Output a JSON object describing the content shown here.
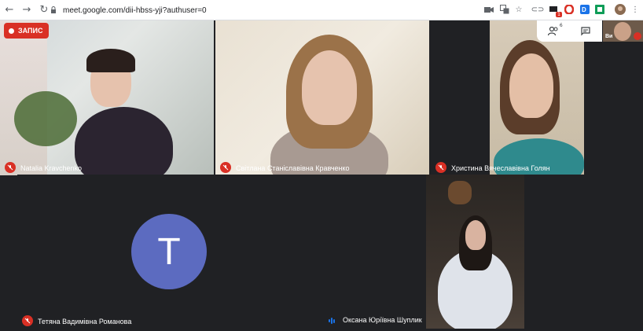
{
  "browser": {
    "url": "meet.google.com/dii-hbss-yji?authuser=0",
    "nav": {
      "back": "←",
      "forward": "→",
      "reload": "↻"
    },
    "extensions": [
      "camera-icon",
      "translate-icon",
      "star-icon",
      "link-icon",
      "mail-icon",
      "opera-icon",
      "dp-icon",
      "sheets-icon",
      "profile-icon",
      "menu-icon"
    ],
    "badge_count": "1"
  },
  "recording": {
    "label": "ЗАПИС",
    "color": "#d93025"
  },
  "panel": {
    "people_count": "6"
  },
  "self": {
    "label": "Ви"
  },
  "tiles": [
    {
      "name": "Natalia Kravchenko",
      "muted": true
    },
    {
      "name": "Світлана Станіславівна Кравченко",
      "muted": true
    },
    {
      "name": "Христина Вячеславівна Голян",
      "muted": true
    },
    {
      "name": "Тетяна Вадимівна Романова",
      "muted": true,
      "avatar_letter": "T",
      "avatar_color": "#5c6bc0"
    },
    {
      "name": "Оксана Юріївна Шуплик",
      "muted": false,
      "speaking": true
    }
  ]
}
